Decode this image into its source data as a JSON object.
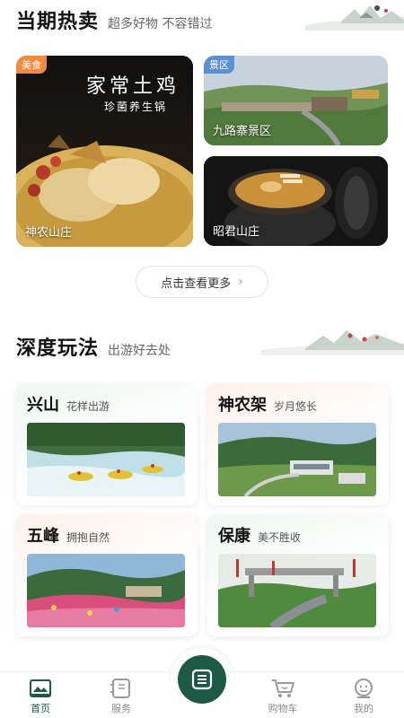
{
  "hot": {
    "title": "当期热卖",
    "subtitle": "超多好物 不容错过",
    "cards": [
      {
        "tag": "美食",
        "name": "神农山庄",
        "headline": "家常土鸡",
        "subline": "珍菌养生锅"
      },
      {
        "tag": "景区",
        "name": "九路寨景区"
      },
      {
        "name": "昭君山庄"
      }
    ],
    "more_label": "点击查看更多"
  },
  "play": {
    "title": "深度玩法",
    "subtitle": "出游好去处",
    "cards": [
      {
        "title": "兴山",
        "subtitle": "花样出游"
      },
      {
        "title": "神农架",
        "subtitle": "岁月悠长"
      },
      {
        "title": "五峰",
        "subtitle": "拥抱自然"
      },
      {
        "title": "保康",
        "subtitle": "美不胜收"
      }
    ]
  },
  "tabbar": {
    "items": [
      {
        "label": "首页",
        "icon": "home-icon"
      },
      {
        "label": "服务",
        "icon": "service-icon"
      },
      {
        "label": "购物车",
        "icon": "cart-icon"
      },
      {
        "label": "我的",
        "icon": "user-icon"
      }
    ],
    "center_icon": "menu-doc-icon"
  },
  "colors": {
    "brand_green": "#1d5a45",
    "tag_orange": "#f08a3c",
    "tag_blue": "#5b8fd6"
  }
}
